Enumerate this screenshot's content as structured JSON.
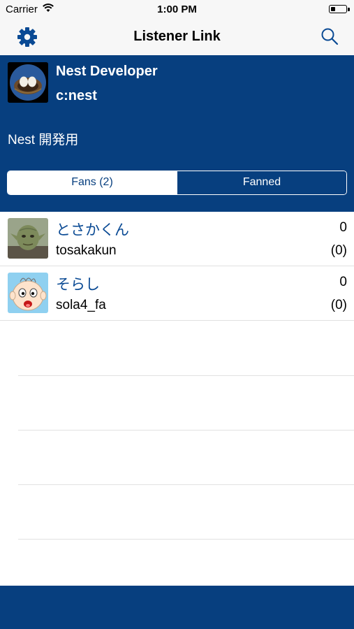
{
  "status_bar": {
    "carrier": "Carrier",
    "time": "1:00 PM"
  },
  "nav": {
    "title": "Listener Link",
    "left_icon": "gear-icon",
    "right_icon": "search-icon"
  },
  "profile": {
    "name": "Nest Developer",
    "handle": "c:nest",
    "description": "Nest 開発用",
    "avatar_icon": "nest-eggs-avatar"
  },
  "segments": {
    "fans": "Fans (2)",
    "fanned": "Fanned"
  },
  "fans": [
    {
      "display_name": "とさかくん",
      "user_id": "tosakakun",
      "count": "0",
      "sub_count": "(0)",
      "avatar": "yoda-avatar"
    },
    {
      "display_name": "そらし",
      "user_id": "sola4_fa",
      "count": "0",
      "sub_count": "(0)",
      "avatar": "cartoon-face-avatar"
    }
  ],
  "colors": {
    "brand_blue": "#073f7f",
    "link_blue": "#0a4a94",
    "bar_background": "#f7f7f7",
    "separator": "#e1e1e1"
  }
}
